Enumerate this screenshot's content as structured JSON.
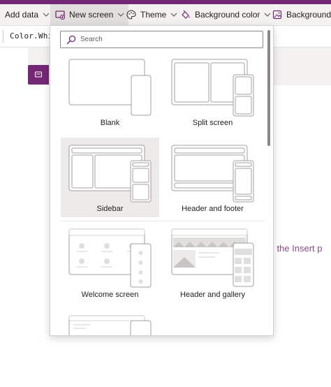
{
  "toolbar": {
    "items": [
      {
        "label": "Add data",
        "icon": "none"
      },
      {
        "label": "New screen",
        "icon": "new-screen-icon"
      },
      {
        "label": "Theme",
        "icon": "palette-icon"
      },
      {
        "label": "Background color",
        "icon": "paint-bucket-icon"
      },
      {
        "label": "Background in",
        "icon": "image-icon"
      }
    ]
  },
  "formula": {
    "text": "Color.Whit"
  },
  "canvas": {
    "hint": "m the Insert p"
  },
  "new_screen_menu": {
    "search_placeholder": "Search",
    "templates": [
      {
        "label": "Blank"
      },
      {
        "label": "Split screen"
      },
      {
        "label": "Sidebar",
        "selected": true
      },
      {
        "label": "Header and footer"
      },
      {
        "label": "Welcome screen"
      },
      {
        "label": "Header and gallery"
      }
    ]
  },
  "colors": {
    "accent": "#742774",
    "toolbar_bg": "#f3f2f1",
    "selected_tile": "#edebe9"
  }
}
